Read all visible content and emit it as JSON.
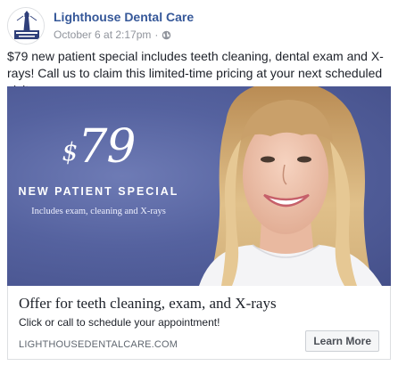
{
  "page": {
    "name": "Lighthouse Dental Care",
    "timestamp": "October 6 at 2:17pm",
    "separator": "·",
    "audience_icon": "globe-icon",
    "avatar_icon": "lighthouse-logo-icon"
  },
  "post": {
    "caption": "$79 new patient special includes teeth cleaning, dental exam and X-rays! Call us to claim this limited-time pricing at your next scheduled visit."
  },
  "ad_image": {
    "price_symbol": "$",
    "price_value": "79",
    "headline": "NEW PATIENT SPECIAL",
    "trademark": "·",
    "subline": "Includes exam, cleaning and X-rays",
    "background_color": "#55629f"
  },
  "link_card": {
    "title": "Offer for teeth cleaning, exam, and X-rays",
    "description": "Click or call to schedule your appointment!",
    "domain": "LIGHTHOUSEDENTALCARE.COM",
    "cta_label": "Learn More"
  },
  "colors": {
    "page_name": "#365899",
    "meta_text": "#90949c",
    "card_border": "#dddfe2",
    "button_bg": "#f5f6f7"
  }
}
